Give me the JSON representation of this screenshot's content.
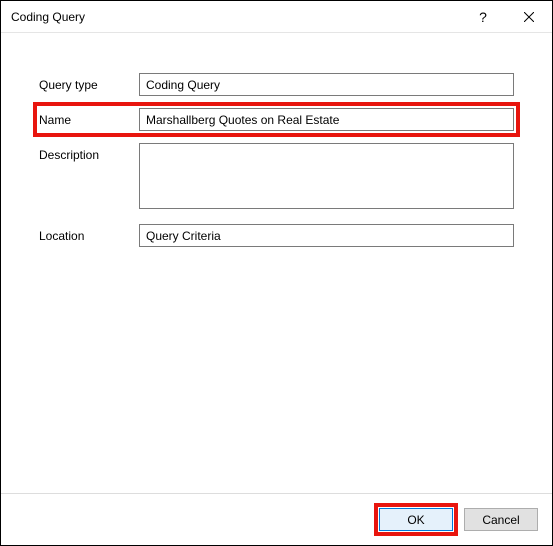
{
  "window": {
    "title": "Coding Query"
  },
  "labels": {
    "query_type": "Query type",
    "name": "Name",
    "description": "Description",
    "location": "Location"
  },
  "fields": {
    "query_type": "Coding Query",
    "name": "Marshallberg Quotes on Real Estate",
    "description": "",
    "location": "Query Criteria"
  },
  "buttons": {
    "help": "?",
    "ok": "OK",
    "cancel": "Cancel"
  }
}
